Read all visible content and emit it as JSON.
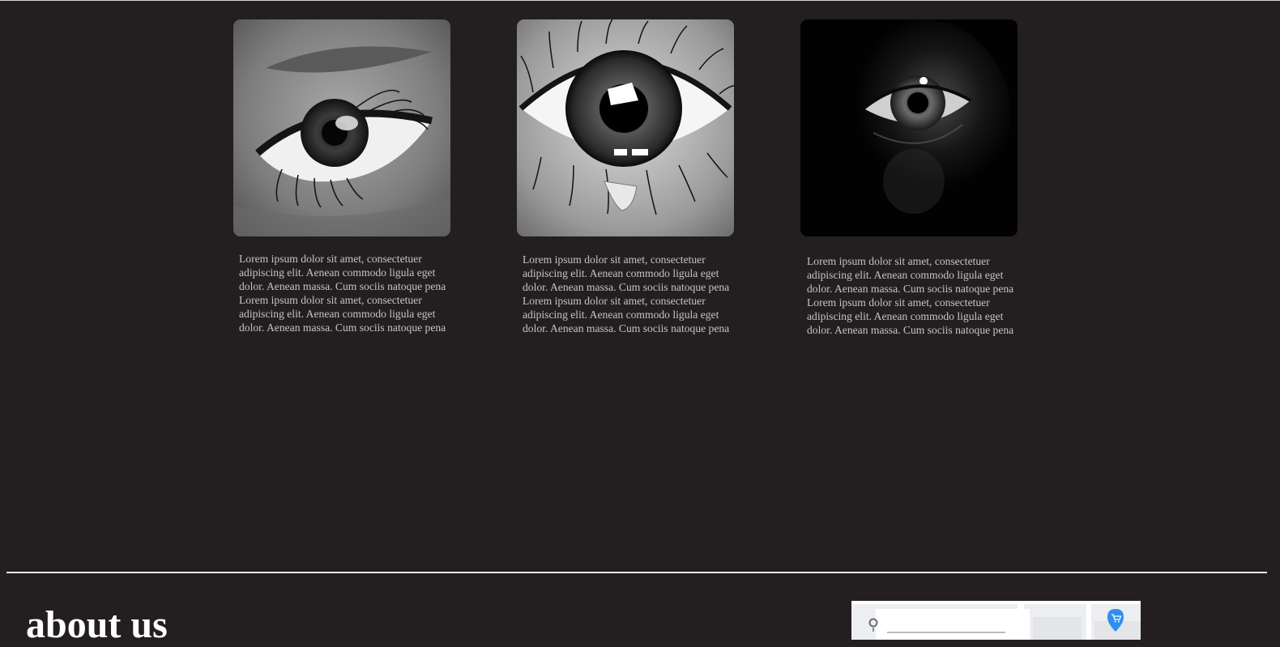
{
  "cards": [
    {
      "image": "grayscale-eye-with-lashes",
      "lines": [
        "Lorem ipsum dolor sit amet, consectetuer",
        "adipiscing elit. Aenean commodo ligula eget",
        "dolor. Aenean massa. Cum sociis natoque pena",
        "Lorem ipsum dolor sit amet, consectetuer",
        "adipiscing elit. Aenean commodo ligula eget",
        "dolor. Aenean massa. Cum sociis natoque pena"
      ]
    },
    {
      "image": "tearful-eye-illustration",
      "lines": [
        "Lorem ipsum dolor sit amet, consectetuer",
        "adipiscing elit. Aenean commodo ligula eget",
        "dolor. Aenean massa. Cum sociis natoque pena",
        "Lorem ipsum dolor sit amet, consectetuer",
        "adipiscing elit. Aenean commodo ligula eget",
        "dolor. Aenean massa. Cum sociis natoque pena"
      ]
    },
    {
      "image": "eye-in-darkness",
      "lines": [
        "Lorem ipsum dolor sit amet, consectetuer",
        "adipiscing elit. Aenean commodo ligula eget",
        "dolor. Aenean massa. Cum sociis natoque pena",
        "Lorem ipsum dolor sit amet, consectetuer",
        "adipiscing elit. Aenean commodo ligula eget",
        "dolor. Aenean massa. Cum sociis natoque pena"
      ]
    }
  ],
  "about": {
    "title": "about us"
  },
  "map": {
    "pin_icon": "shopping-cart-pin-icon",
    "location_icon": "location-dot-icon"
  },
  "colors": {
    "background": "#231f20",
    "text": "#c9c2c4",
    "heading": "#ffffff",
    "divider": "#e9e6e6",
    "map_pin": "#2f8ff0"
  }
}
